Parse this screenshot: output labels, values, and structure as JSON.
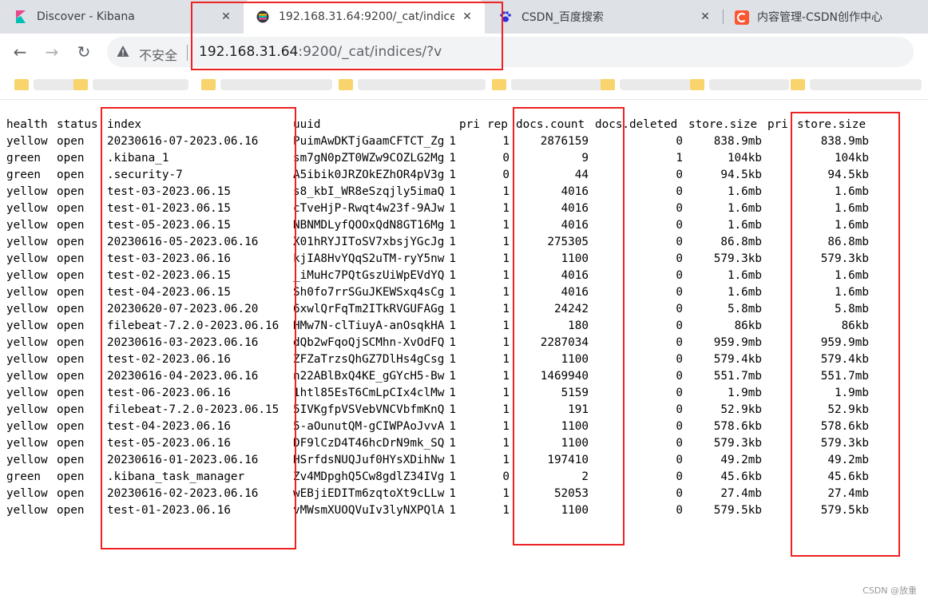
{
  "tabs": [
    {
      "title": "Discover - Kibana",
      "favicon": "kibana-icon"
    },
    {
      "title": "192.168.31.64:9200/_cat/indice",
      "favicon": "elastic-icon",
      "active": true
    },
    {
      "title": "CSDN_百度搜索",
      "favicon": "baidu-paw-icon"
    },
    {
      "title": "内容管理-CSDN创作中心",
      "favicon": "csdn-icon"
    }
  ],
  "close_glyph": "✕",
  "toolbar": {
    "back": "←",
    "forward": "→",
    "reload": "↻",
    "security_label": "不安全",
    "url_host": "192.168.31.64",
    "url_rest": ":9200/_cat/indices/?v"
  },
  "table": {
    "headers": [
      "health",
      "status",
      "index",
      "uuid",
      "pri",
      "rep",
      "docs.count",
      "docs.deleted",
      "store.size",
      "pri",
      "store.size"
    ],
    "rows": [
      [
        "yellow",
        "open",
        "20230616-07-2023.06.16",
        "PuimAwDKTjGaamCFTCT_Zg",
        "1",
        "1",
        "2876159",
        "0",
        "838.9mb",
        "838.9mb"
      ],
      [
        "green",
        "open",
        ".kibana_1",
        "sm7gN0pZT0WZw9COZLG2Mg",
        "1",
        "0",
        "9",
        "1",
        "104kb",
        "104kb"
      ],
      [
        "green",
        "open",
        ".security-7",
        "A5ibik0JRZOkEZhOR4pV3g",
        "1",
        "0",
        "44",
        "0",
        "94.5kb",
        "94.5kb"
      ],
      [
        "yellow",
        "open",
        "test-03-2023.06.15",
        "s8_kbI_WR8eSzqjly5imaQ",
        "1",
        "1",
        "4016",
        "0",
        "1.6mb",
        "1.6mb"
      ],
      [
        "yellow",
        "open",
        "test-01-2023.06.15",
        "cTveHjP-Rwqt4w23f-9AJw",
        "1",
        "1",
        "4016",
        "0",
        "1.6mb",
        "1.6mb"
      ],
      [
        "yellow",
        "open",
        "test-05-2023.06.15",
        "NBNMDLyfQOOxQdN8GT16Mg",
        "1",
        "1",
        "4016",
        "0",
        "1.6mb",
        "1.6mb"
      ],
      [
        "yellow",
        "open",
        "20230616-05-2023.06.16",
        "X01hRYJIToSV7xbsjYGcJg",
        "1",
        "1",
        "275305",
        "0",
        "86.8mb",
        "86.8mb"
      ],
      [
        "yellow",
        "open",
        "test-03-2023.06.16",
        "kjIA8HvYQqS2uTM-ryY5nw",
        "1",
        "1",
        "1100",
        "0",
        "579.3kb",
        "579.3kb"
      ],
      [
        "yellow",
        "open",
        "test-02-2023.06.15",
        "_iMuHc7PQtGszUiWpEVdYQ",
        "1",
        "1",
        "4016",
        "0",
        "1.6mb",
        "1.6mb"
      ],
      [
        "yellow",
        "open",
        "test-04-2023.06.15",
        "Sh0fo7rrSGuJKEWSxq4sCg",
        "1",
        "1",
        "4016",
        "0",
        "1.6mb",
        "1.6mb"
      ],
      [
        "yellow",
        "open",
        "20230620-07-2023.06.20",
        "6xwlQrFqTm2ITkRVGUFAGg",
        "1",
        "1",
        "24242",
        "0",
        "5.8mb",
        "5.8mb"
      ],
      [
        "yellow",
        "open",
        "filebeat-7.2.0-2023.06.16",
        "HMw7N-clTiuyA-anOsqkHA",
        "1",
        "1",
        "180",
        "0",
        "86kb",
        "86kb"
      ],
      [
        "yellow",
        "open",
        "20230616-03-2023.06.16",
        "dQb2wFqoQjSCMhn-XvOdFQ",
        "1",
        "1",
        "2287034",
        "0",
        "959.9mb",
        "959.9mb"
      ],
      [
        "yellow",
        "open",
        "test-02-2023.06.16",
        "ZFZaTrzsQhGZ7DlHs4gCsg",
        "1",
        "1",
        "1100",
        "0",
        "579.4kb",
        "579.4kb"
      ],
      [
        "yellow",
        "open",
        "20230616-04-2023.06.16",
        "n22ABlBxQ4KE_gGYcH5-Bw",
        "1",
        "1",
        "1469940",
        "0",
        "551.7mb",
        "551.7mb"
      ],
      [
        "yellow",
        "open",
        "test-06-2023.06.16",
        "1htl85EsT6CmLpCIx4clMw",
        "1",
        "1",
        "5159",
        "0",
        "1.9mb",
        "1.9mb"
      ],
      [
        "yellow",
        "open",
        "filebeat-7.2.0-2023.06.15",
        "5IVKgfpVSVebVNCVbfmKnQ",
        "1",
        "1",
        "191",
        "0",
        "52.9kb",
        "52.9kb"
      ],
      [
        "yellow",
        "open",
        "test-04-2023.06.16",
        "5-aOunutQM-gCIWPAoJvvA",
        "1",
        "1",
        "1100",
        "0",
        "578.6kb",
        "578.6kb"
      ],
      [
        "yellow",
        "open",
        "test-05-2023.06.16",
        "DF9lCzD4T46hcDrN9mk_SQ",
        "1",
        "1",
        "1100",
        "0",
        "579.3kb",
        "579.3kb"
      ],
      [
        "yellow",
        "open",
        "20230616-01-2023.06.16",
        "HSrfdsNUQJuf0HYsXDihNw",
        "1",
        "1",
        "197410",
        "0",
        "49.2mb",
        "49.2mb"
      ],
      [
        "green",
        "open",
        ".kibana_task_manager",
        "Zv4MDpghQ5Cw8gdlZ34IVg",
        "1",
        "0",
        "2",
        "0",
        "45.6kb",
        "45.6kb"
      ],
      [
        "yellow",
        "open",
        "20230616-02-2023.06.16",
        "wEBjiEDITm6zqtoXt9cLLw",
        "1",
        "1",
        "52053",
        "0",
        "27.4mb",
        "27.4mb"
      ],
      [
        "yellow",
        "open",
        "test-01-2023.06.16",
        "vMWsmXUOQVuIv3lyNXPQlA",
        "1",
        "1",
        "1100",
        "0",
        "579.5kb",
        "579.5kb"
      ]
    ]
  },
  "watermark": "CSDN @放重",
  "colors": {
    "highlight": "#e22222",
    "tab_strip": "#dee1e6",
    "omnibox": "#f1f3f4"
  }
}
